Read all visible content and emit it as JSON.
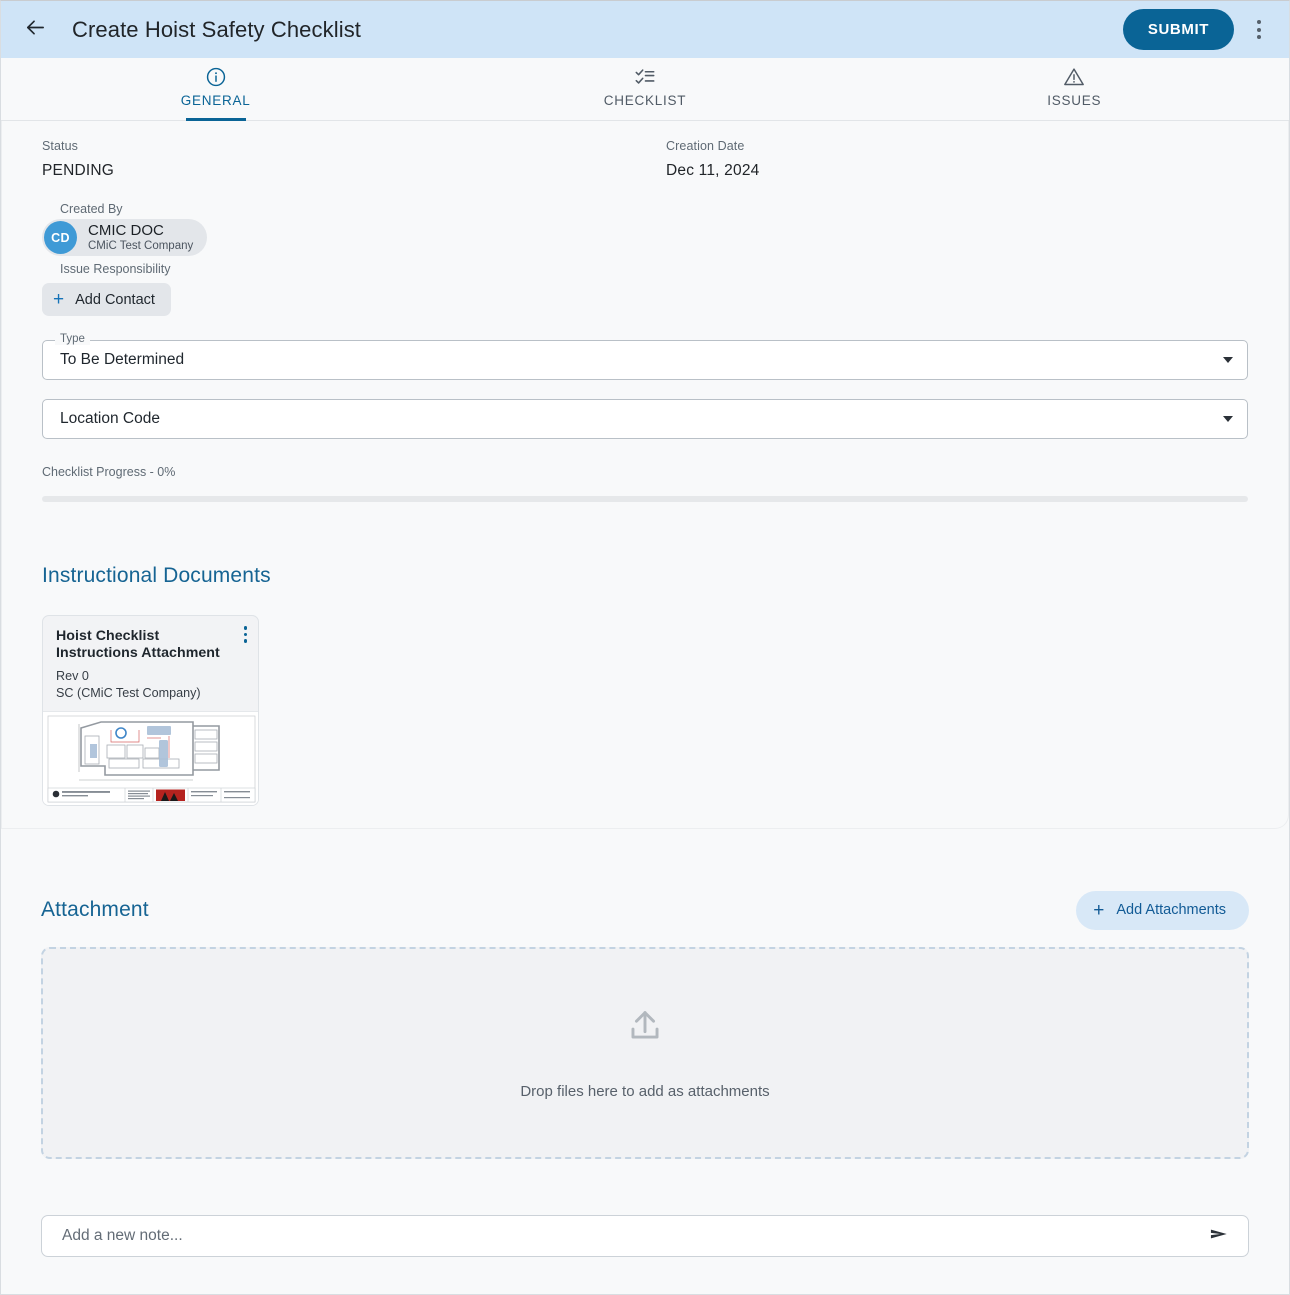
{
  "appbar": {
    "title": "Create Hoist Safety Checklist",
    "back_icon": "arrow-left-icon",
    "submit_label": "SUBMIT",
    "overflow_icon": "more-vertical-icon",
    "bar_color": "#cfe4f7",
    "accent_color": "#0a6496"
  },
  "tabs": [
    {
      "label": "GENERAL",
      "icon": "info-circle-icon",
      "active": true
    },
    {
      "label": "CHECKLIST",
      "icon": "checklist-icon",
      "active": false
    },
    {
      "label": "ISSUES",
      "icon": "warning-triangle-icon",
      "active": false
    }
  ],
  "general": {
    "status_label": "Status",
    "status_value": "PENDING",
    "creation_date_label": "Creation Date",
    "creation_date_value": "Dec 11, 2024",
    "created_by_label": "Created By",
    "created_by": {
      "initials": "CD",
      "name": "CMIC DOC",
      "company": "CMiC Test Company",
      "avatar_color": "#3f9ad6"
    },
    "issue_responsibility_label": "Issue Responsibility",
    "add_contact_label": "Add Contact",
    "type_label": "Type",
    "type_value": "To Be Determined",
    "location_code_value": "Location Code",
    "progress_label": "Checklist Progress - 0%",
    "progress_percent": 0
  },
  "instructional_documents": {
    "title": "Instructional Documents",
    "cards": [
      {
        "title": "Hoist Checklist Instructions Attachment",
        "rev": "Rev 0",
        "owner": "SC (CMiC Test Company)",
        "menu_icon": "more-vertical-icon",
        "thumbnail": "floor-plan-drawing"
      }
    ]
  },
  "attachment": {
    "title": "Attachment",
    "add_label": "Add Attachments",
    "dropzone_icon": "upload-icon",
    "dropzone_text": "Drop files here to add as attachments"
  },
  "note": {
    "placeholder": "Add a new note...",
    "value": "",
    "send_icon": "send-icon"
  }
}
